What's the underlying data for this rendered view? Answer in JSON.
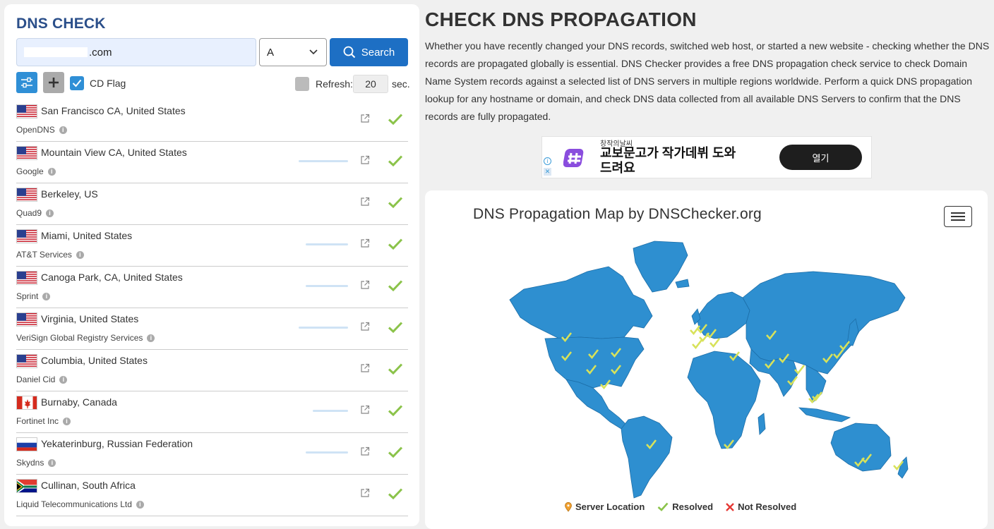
{
  "left": {
    "title": "DNS CHECK",
    "domain_value": ".com",
    "record_type": "A",
    "search_label": "Search",
    "cd_flag_label": "CD Flag",
    "refresh_label": "Refresh:",
    "refresh_value": "20",
    "refresh_unit": "sec.",
    "servers": [
      {
        "location": "San Francisco CA, United States",
        "provider": "OpenDNS",
        "flag": "us",
        "status": "resolved"
      },
      {
        "location": "Mountain View CA, United States",
        "provider": "Google",
        "flag": "us",
        "status": "resolved"
      },
      {
        "location": "Berkeley, US",
        "provider": "Quad9",
        "flag": "us",
        "status": "resolved"
      },
      {
        "location": "Miami, United States",
        "provider": "AT&T Services",
        "flag": "us",
        "status": "resolved"
      },
      {
        "location": "Canoga Park, CA, United States",
        "provider": "Sprint",
        "flag": "us",
        "status": "resolved"
      },
      {
        "location": "Virginia, United States",
        "provider": "VeriSign Global Registry Services",
        "flag": "us",
        "status": "resolved"
      },
      {
        "location": "Columbia, United States",
        "provider": "Daniel Cid",
        "flag": "us",
        "status": "resolved"
      },
      {
        "location": "Burnaby, Canada",
        "provider": "Fortinet Inc",
        "flag": "ca",
        "status": "resolved"
      },
      {
        "location": "Yekaterinburg, Russian Federation",
        "provider": "Skydns",
        "flag": "ru",
        "status": "resolved"
      },
      {
        "location": "Cullinan, South Africa",
        "provider": "Liquid Telecommunications Ltd",
        "flag": "za",
        "status": "resolved"
      }
    ]
  },
  "right": {
    "heading": "CHECK DNS PROPAGATION",
    "intro": "Whether you have recently changed your DNS records, switched web host, or started a new website - checking whether the DNS records are propagated globally is essential. DNS Checker provides a free DNS propagation check service to check Domain Name System records against a selected list of DNS servers in multiple regions worldwide. Perform a quick DNS propagation lookup for any hostname or domain, and check DNS data collected from all available DNS Servers to confirm that the DNS records are fully propagated.",
    "ad": {
      "small_text": "창작의날씨",
      "headline": "교보문고가 작가데뷔 도와드려요",
      "button": "열기"
    },
    "map": {
      "title": "DNS Propagation Map by DNSChecker.org",
      "legend": {
        "server_location": "Server Location",
        "resolved": "Resolved",
        "not_resolved": "Not Resolved"
      }
    }
  },
  "colors": {
    "title_blue": "#2b4f8a",
    "button_blue": "#1d6fc4",
    "map_blue": "#2e8fd0",
    "check_green": "#8bc34a",
    "resolved_yellow": "#c9d94a",
    "error_red": "#e53935"
  }
}
